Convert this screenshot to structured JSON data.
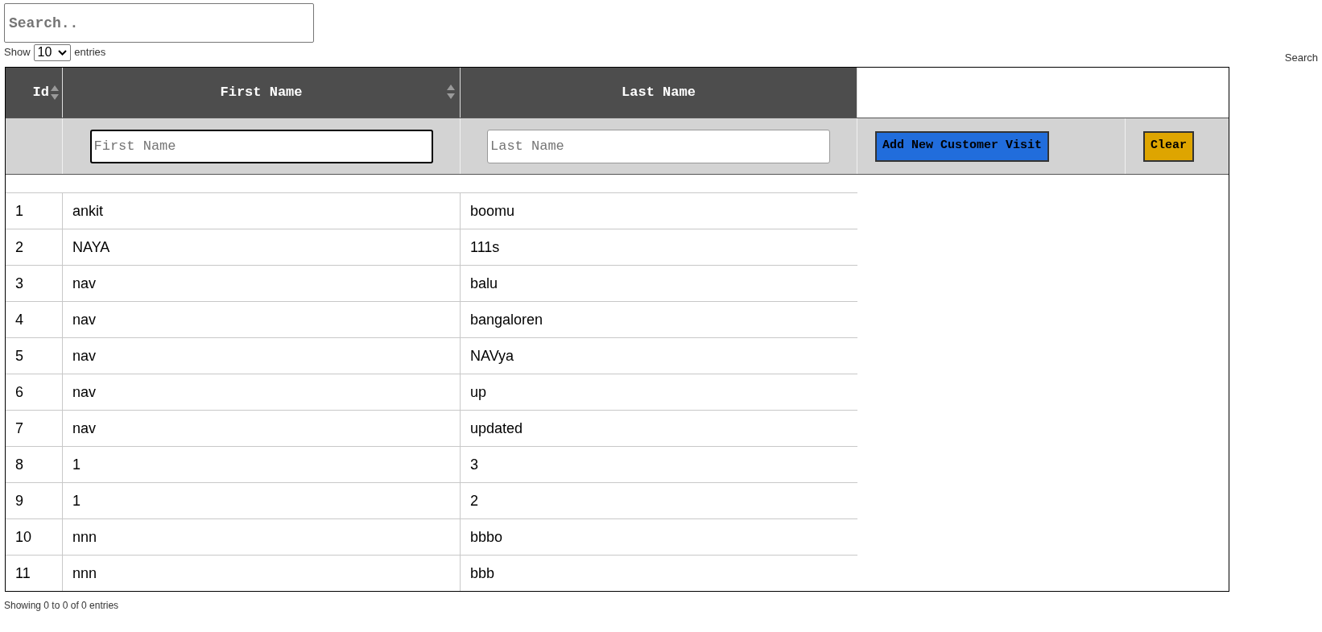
{
  "search": {
    "placeholder": "Search.."
  },
  "length": {
    "label_before": "Show",
    "value": "10",
    "label_after": "entries"
  },
  "search_label": "Search",
  "table": {
    "columns": [
      {
        "label": "Id",
        "sortable": true
      },
      {
        "label": "First Name",
        "sortable": true
      },
      {
        "label": "Last Name",
        "sortable": false
      }
    ],
    "filters": [
      {
        "placeholder": "First Name",
        "focused": true
      },
      {
        "placeholder": "Last Name",
        "focused": false
      }
    ],
    "buttons": [
      {
        "label": "Add New Customer Visit",
        "kind": "add"
      },
      {
        "label": "Clear",
        "kind": "clear"
      }
    ],
    "rows": [
      [
        "1",
        "ankit",
        "boomu"
      ],
      [
        "2",
        "NAYA",
        "111s"
      ],
      [
        "3",
        "nav",
        "balu"
      ],
      [
        "4",
        "nav",
        "bangaloren"
      ],
      [
        "5",
        "nav",
        "NAVya"
      ],
      [
        "6",
        "nav",
        "up"
      ],
      [
        "7",
        "nav",
        "updated"
      ],
      [
        "8",
        "1",
        "3"
      ],
      [
        "9",
        "1",
        "2"
      ],
      [
        "10",
        "nnn",
        "bbbo"
      ],
      [
        "11",
        "nnn",
        "bbb"
      ]
    ]
  },
  "info": "Showing 0 to 0 of 0 entries"
}
